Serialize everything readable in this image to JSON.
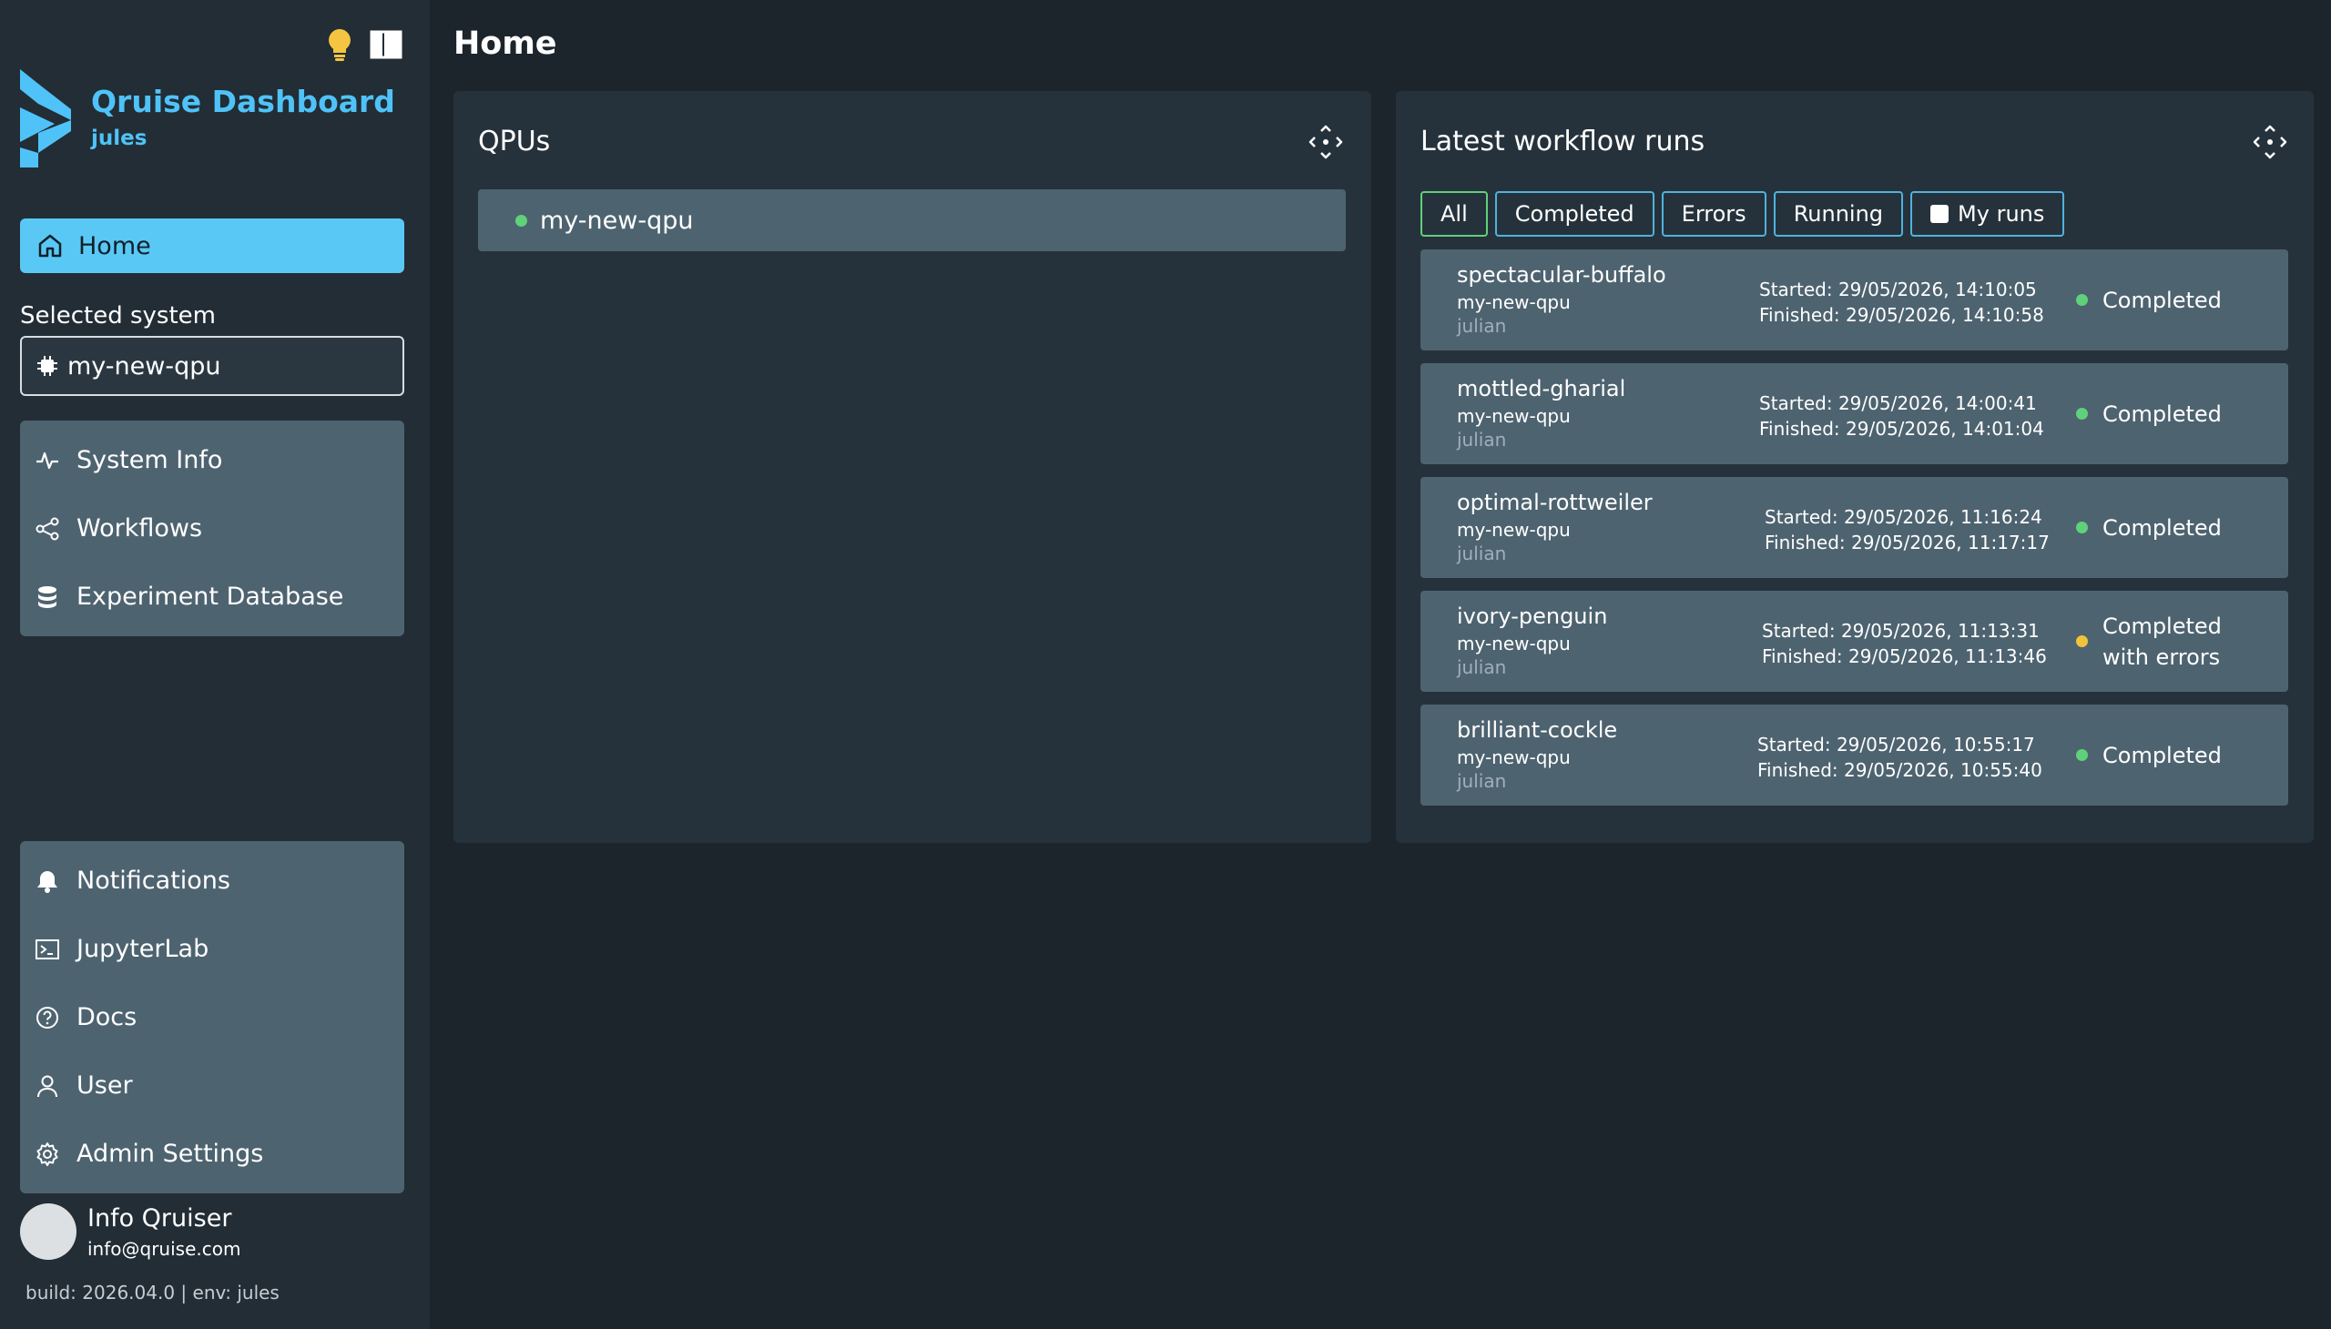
{
  "app": {
    "title": "Qruise Dashboard",
    "user": "jules"
  },
  "sidebar": {
    "home_label": "Home",
    "selected_system_label": "Selected system",
    "selected_system_value": "my-new-qpu",
    "nav": [
      {
        "label": "System Info",
        "icon": "activity-icon"
      },
      {
        "label": "Workflows",
        "icon": "workflow-icon"
      },
      {
        "label": "Experiment Database",
        "icon": "database-icon"
      }
    ],
    "bottom_nav": [
      {
        "label": "Notifications",
        "icon": "bell-icon"
      },
      {
        "label": "JupyterLab",
        "icon": "terminal-icon"
      },
      {
        "label": "Docs",
        "icon": "help-circle-icon"
      },
      {
        "label": "User",
        "icon": "user-icon"
      },
      {
        "label": "Admin Settings",
        "icon": "gear-icon"
      }
    ],
    "profile": {
      "name": "Info Qruiser",
      "email": "info@qruise.com"
    },
    "build_info": "build: 2026.04.0 | env: jules"
  },
  "main": {
    "page_title": "Home",
    "qpus_panel": {
      "title": "QPUs",
      "items": [
        "my-new-qpu"
      ]
    },
    "runs_panel": {
      "title": "Latest workflow runs",
      "filters": [
        "All",
        "Completed",
        "Errors",
        "Running",
        "My runs"
      ],
      "active_filter": "All",
      "runs": [
        {
          "name": "spectacular-buffalo",
          "qpu": "my-new-qpu",
          "user": "julian",
          "started": "Started: 29/05/2026, 14:10:05",
          "finished": "Finished: 29/05/2026, 14:10:58",
          "status_line1": "Completed",
          "status_line2": "",
          "status_color": "green"
        },
        {
          "name": "mottled-gharial",
          "qpu": "my-new-qpu",
          "user": "julian",
          "started": "Started: 29/05/2026, 14:00:41",
          "finished": "Finished: 29/05/2026, 14:01:04",
          "status_line1": "Completed",
          "status_line2": "",
          "status_color": "green"
        },
        {
          "name": "optimal-rottweiler",
          "qpu": "my-new-qpu",
          "user": "julian",
          "started": "Started: 29/05/2026, 11:16:24",
          "finished": "Finished: 29/05/2026, 11:17:17",
          "status_line1": "Completed",
          "status_line2": "",
          "status_color": "green"
        },
        {
          "name": "ivory-penguin",
          "qpu": "my-new-qpu",
          "user": "julian",
          "started": "Started: 29/05/2026, 11:13:31",
          "finished": "Finished: 29/05/2026, 11:13:46",
          "status_line1": "Completed",
          "status_line2": "with errors",
          "status_color": "yellow"
        },
        {
          "name": "brilliant-cockle",
          "qpu": "my-new-qpu",
          "user": "julian",
          "started": "Started: 29/05/2026, 10:55:17",
          "finished": "Finished: 29/05/2026, 10:55:40",
          "status_line1": "Completed",
          "status_line2": "",
          "status_color": "green"
        }
      ]
    }
  },
  "colors": {
    "accent": "#5ac8f5",
    "status_green": "#5fd17a",
    "status_yellow": "#f0c43a"
  }
}
